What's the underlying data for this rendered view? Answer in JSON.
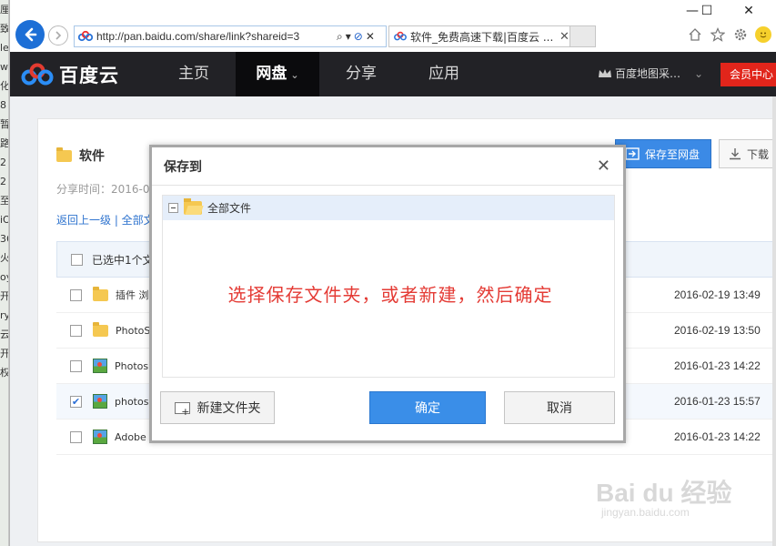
{
  "background_window": {
    "chars": [
      "厘",
      "致",
      "",
      "le",
      "w",
      "",
      "化",
      "8",
      "暂",
      "路",
      "",
      "2",
      "2",
      "",
      "至",
      "iO",
      "36",
      "火",
      "oy",
      "开",
      "ry",
      "云",
      "开",
      "权",
      "",
      "",
      ""
    ]
  },
  "browser": {
    "url": "http://pan.baidu.com/share/link?shareid=3",
    "tab_title": "软件_免费高速下载|百度云 ...",
    "tab_close": "✕",
    "window_controls": {
      "minimize": "—",
      "maximize": "☐",
      "close": "✕"
    },
    "address_icons": {
      "search": "⌕",
      "dropdown": "▾",
      "stop": "⊘",
      "refresh": "↻"
    },
    "toolbar_icons": [
      "home-icon",
      "star-icon",
      "gear-icon",
      "smiley-icon"
    ]
  },
  "header": {
    "logo_text": "百度云",
    "nav": [
      {
        "label": "主页"
      },
      {
        "label": "网盘",
        "caret": "⌄"
      },
      {
        "label": "分享"
      },
      {
        "label": "应用"
      }
    ],
    "user_name": "百度地图采…",
    "user_caret": "⌄",
    "vip_label": "会员中心"
  },
  "share": {
    "title": "软件",
    "time_label": "分享时间：2016-02",
    "breadcrumb": "返回上一级 | 全部文",
    "save_button": "保存至网盘",
    "download_button": "下载",
    "selected_text": "已选中1个文",
    "rows": [
      {
        "name": "插件 浏",
        "date": "2016-02-19 13:49",
        "type": "folder",
        "checked": false
      },
      {
        "name": "PhotoS",
        "date": "2016-02-19 13:50",
        "type": "folder",
        "checked": false
      },
      {
        "name": "Photos",
        "date": "2016-01-23 14:22",
        "type": "image",
        "checked": false
      },
      {
        "name": "photos",
        "date": "2016-01-23 15:57",
        "type": "image",
        "checked": true
      },
      {
        "name": "Adobe",
        "date": "2016-01-23 14:22",
        "type": "image",
        "checked": false
      }
    ]
  },
  "modal": {
    "title": "保存到",
    "close": "✕",
    "root_folder": "全部文件",
    "annotation": "选择保存文件夹，或者新建，然后确定",
    "new_folder_button": "新建文件夹",
    "ok_button": "确定",
    "cancel_button": "取消"
  },
  "watermark": {
    "main": "Bai du 经验",
    "sub": "jingyan.baidu.com"
  },
  "colors": {
    "accent": "#3a8ee8",
    "header_bg": "#222226",
    "vip": "#e1251b",
    "annotation": "#e43b35"
  }
}
